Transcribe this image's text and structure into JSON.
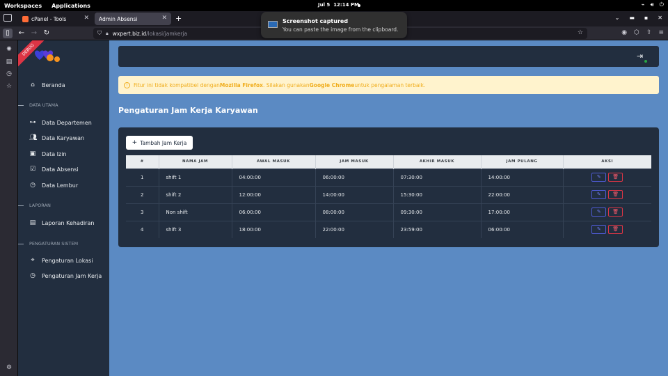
{
  "topbar": {
    "workspaces": "Workspaces",
    "applications": "Applications",
    "date": "Jul 5",
    "time": "12:14 PM"
  },
  "tabs": [
    {
      "title": "cPanel - Tools"
    },
    {
      "title": "Admin Absensi"
    }
  ],
  "url": {
    "host": "wxpert.biz.id",
    "path": "/lokasi/jamkerja"
  },
  "notification": {
    "title": "Screenshot captured",
    "body": "You can paste the image from the clipboard."
  },
  "sidebar": {
    "ribbon": "DEBUG",
    "home": "Beranda",
    "section_data": "DATA UTAMA",
    "data_items": [
      "Data Departemen",
      "Data Karyawan",
      "Data Izin",
      "Data Absensi",
      "Data Lembur"
    ],
    "section_report": "LAPORAN",
    "report_items": [
      "Laporan Kehadiran"
    ],
    "section_settings": "PENGATURAN SISTEM",
    "settings_items": [
      "Pengaturan Lokasi",
      "Pengaturan Jam Kerja"
    ]
  },
  "alert": {
    "prefix": "Fitur ini tidak kompatibel dengan ",
    "firefox": "Mozilla Firefox",
    "middle": ". Silakan gunakan ",
    "chrome": "Google Chrome",
    "suffix": " untuk pengalaman terbaik."
  },
  "page_title": "Pengaturan Jam Kerja Karyawan",
  "add_button": "Tambah Jam Kerja",
  "table": {
    "headers": [
      "#",
      "NAMA JAM",
      "AWAL MASUK",
      "JAM MASUK",
      "AKHIR MASUK",
      "JAM PULANG",
      "AKSI"
    ],
    "rows": [
      [
        "1",
        "shift 1",
        "04:00:00",
        "06:00:00",
        "07:30:00",
        "14:00:00"
      ],
      [
        "2",
        "shift 2",
        "12:00:00",
        "14:00:00",
        "15:30:00",
        "22:00:00"
      ],
      [
        "3",
        "Non shift",
        "06:00:00",
        "08:00:00",
        "09:30:00",
        "17:00:00"
      ],
      [
        "4",
        "shift 3",
        "18:00:00",
        "22:00:00",
        "23:59:00",
        "06:00:00"
      ]
    ]
  },
  "colors": {
    "sidebar": "#222e3f",
    "content_bg": "#5b8ac3",
    "alert_bg": "#fff3cd",
    "alert_text": "#f0ad1c"
  }
}
